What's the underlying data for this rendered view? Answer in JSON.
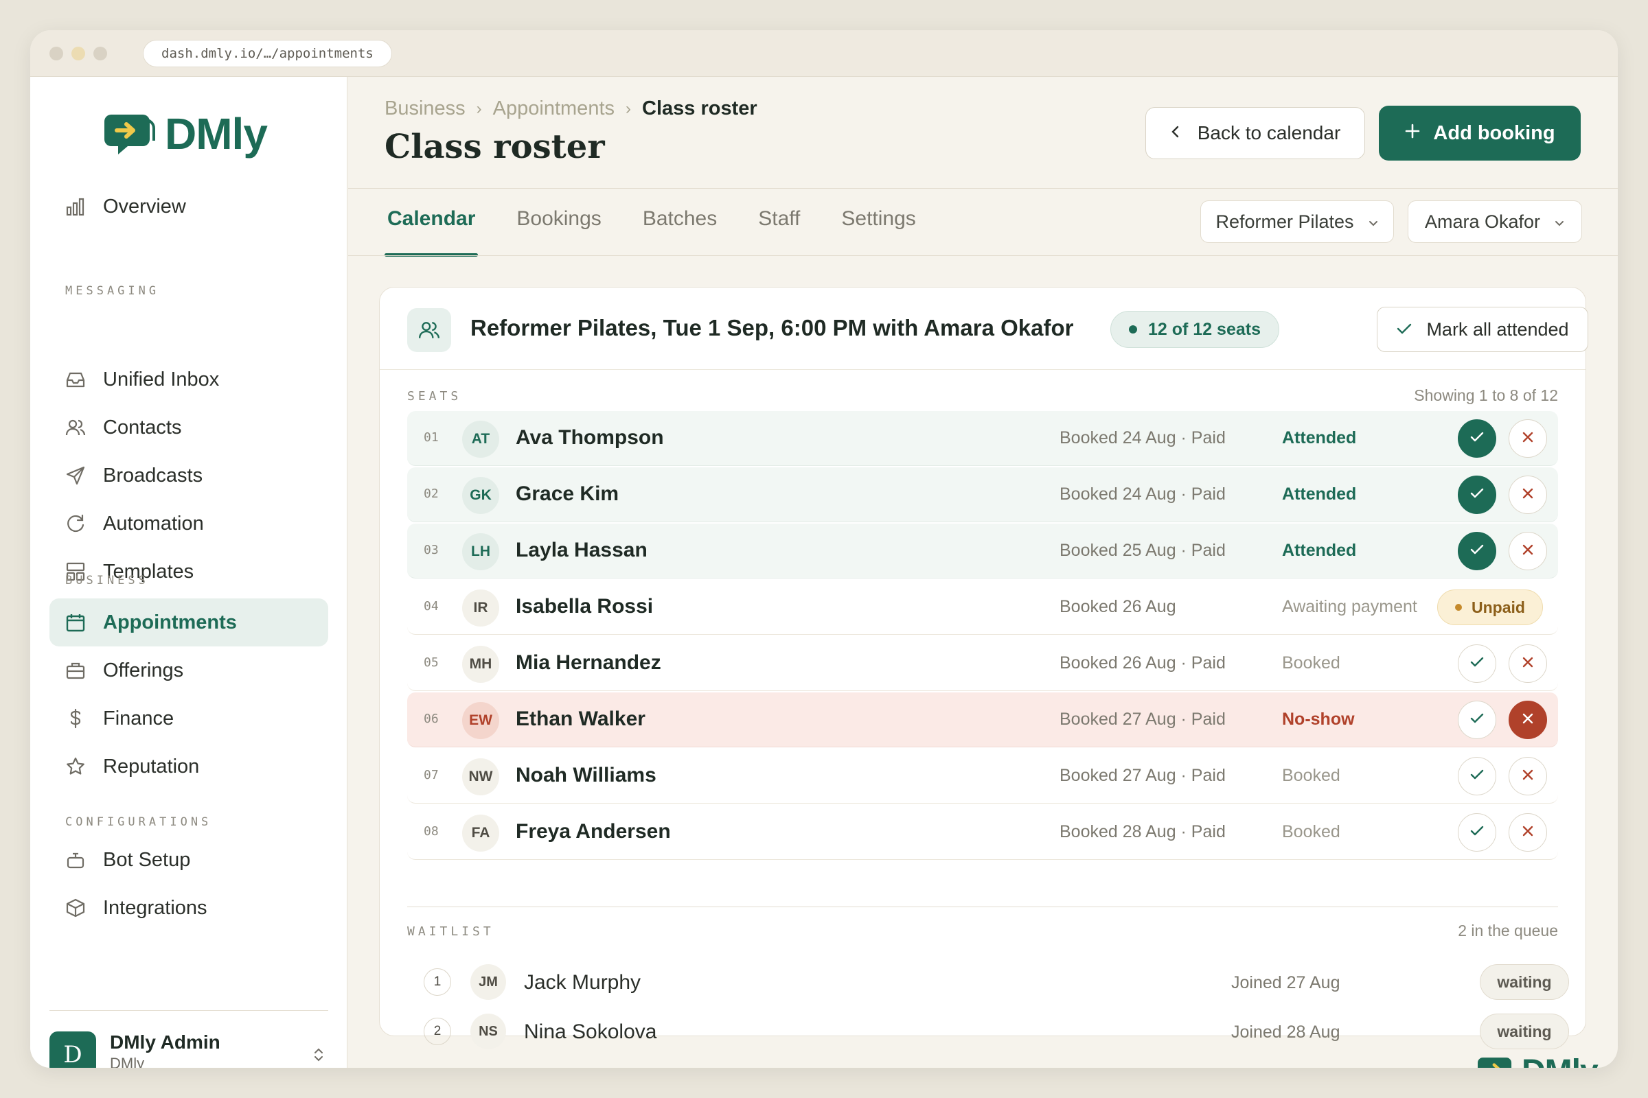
{
  "browser": {
    "url": "dash.dmly.io/…/appointments"
  },
  "sidebar": {
    "logo_text": "DMly",
    "overview": "Overview",
    "sections": {
      "messaging": "MESSAGING",
      "business": "BUSINESS",
      "configurations": "CONFIGURATIONS"
    },
    "items": {
      "unified_inbox": "Unified Inbox",
      "contacts": "Contacts",
      "broadcasts": "Broadcasts",
      "automation": "Automation",
      "templates": "Templates",
      "appointments": "Appointments",
      "offerings": "Offerings",
      "finance": "Finance",
      "reputation": "Reputation",
      "bot_setup": "Bot Setup",
      "integrations": "Integrations"
    },
    "active_item": "Appointments",
    "user": {
      "initial": "D",
      "name": "DMly Admin",
      "org": "DMly"
    }
  },
  "header": {
    "breadcrumb": [
      "Business",
      "Appointments",
      "Class roster"
    ],
    "breadcrumb_sep": "›",
    "title": "Class roster",
    "back_label": "Back to calendar",
    "add_label": "Add booking"
  },
  "tabs": [
    "Calendar",
    "Bookings",
    "Batches",
    "Staff",
    "Settings"
  ],
  "active_tab": "Calendar",
  "filters": {
    "class": "Reformer Pilates",
    "instructor": "Amara Okafor"
  },
  "roster": {
    "title": "Reformer Pilates, Tue 1 Sep, 6:00 PM with Amara Okafor",
    "seats_badge": "12 of 12 seats",
    "mark_all_label": "Mark all attended",
    "seats_label": "SEATS",
    "showing": "Showing 1 to 8 of 12",
    "rows": [
      {
        "num": "01",
        "initials": "AT",
        "name": "Ava Thompson",
        "booked": "Booked 24 Aug · Paid",
        "status": "Attended"
      },
      {
        "num": "02",
        "initials": "GK",
        "name": "Grace Kim",
        "booked": "Booked 24 Aug · Paid",
        "status": "Attended"
      },
      {
        "num": "03",
        "initials": "LH",
        "name": "Layla Hassan",
        "booked": "Booked 25 Aug · Paid",
        "status": "Attended"
      },
      {
        "num": "04",
        "initials": "IR",
        "name": "Isabella Rossi",
        "booked": "Booked 26 Aug",
        "status": "Awaiting payment",
        "badge": "Unpaid"
      },
      {
        "num": "05",
        "initials": "MH",
        "name": "Mia Hernandez",
        "booked": "Booked 26 Aug · Paid",
        "status": "Booked"
      },
      {
        "num": "06",
        "initials": "EW",
        "name": "Ethan Walker",
        "booked": "Booked 27 Aug · Paid",
        "status": "No-show"
      },
      {
        "num": "07",
        "initials": "NW",
        "name": "Noah Williams",
        "booked": "Booked 27 Aug · Paid",
        "status": "Booked"
      },
      {
        "num": "08",
        "initials": "FA",
        "name": "Freya Andersen",
        "booked": "Booked 28 Aug · Paid",
        "status": "Booked"
      }
    ],
    "waitlist_label": "WAITLIST",
    "waitlist_count": "2 in the queue",
    "waitlist": [
      {
        "pos": "1",
        "initials": "JM",
        "name": "Jack Murphy",
        "joined": "Joined 27 Aug",
        "status": "waiting"
      },
      {
        "pos": "2",
        "initials": "NS",
        "name": "Nina Sokolova",
        "joined": "Joined 28 Aug",
        "status": "waiting"
      }
    ]
  },
  "watermark": "DMly",
  "colors": {
    "accent": "#1d6b56",
    "danger": "#b0412a",
    "warning": "#c58a2b",
    "background": "#f6f3ec"
  }
}
